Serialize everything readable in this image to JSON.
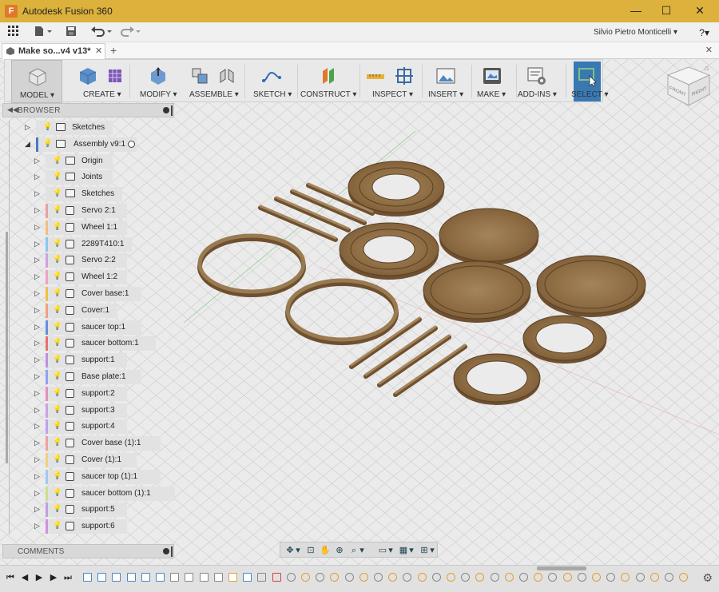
{
  "window": {
    "title": "Autodesk Fusion 360",
    "app_icon": "F",
    "minimize": "—",
    "maximize": "☐",
    "close": "✕"
  },
  "quick_access": {
    "user": "Silvio Pietro Monticelli ▾",
    "help": "?▾"
  },
  "tab": {
    "label": "Make so...v4 v13*",
    "close": "✕",
    "add": "+",
    "close_all": "✕"
  },
  "ribbon": {
    "model": "MODEL ▾",
    "groups": [
      {
        "label": "CREATE ▾"
      },
      {
        "label": "MODIFY ▾"
      },
      {
        "label": "ASSEMBLE ▾"
      },
      {
        "label": "SKETCH ▾"
      },
      {
        "label": "CONSTRUCT ▾"
      },
      {
        "label": "INSPECT ▾"
      },
      {
        "label": "INSERT ▾"
      },
      {
        "label": "MAKE ▾"
      },
      {
        "label": "ADD-INS ▾"
      },
      {
        "label": "SELECT ▾"
      }
    ]
  },
  "viewcube": {
    "top": "FRONT",
    "side": "RIGHT"
  },
  "browser": {
    "title": "BROWSER",
    "items": [
      {
        "label": "Sketches"
      },
      {
        "label": "Assembly v9:1"
      },
      {
        "label": "Origin"
      },
      {
        "label": "Joints"
      },
      {
        "label": "Sketches"
      },
      {
        "label": "Servo 2:1"
      },
      {
        "label": "Wheel 1:1"
      },
      {
        "label": "2289T410:1"
      },
      {
        "label": "Servo 2:2"
      },
      {
        "label": "Wheel 1:2"
      },
      {
        "label": "Cover base:1"
      },
      {
        "label": "Cover:1"
      },
      {
        "label": "saucer top:1"
      },
      {
        "label": "saucer bottom:1"
      },
      {
        "label": "support:1"
      },
      {
        "label": "Base plate:1"
      },
      {
        "label": "support:2"
      },
      {
        "label": "support:3"
      },
      {
        "label": "support:4"
      },
      {
        "label": "Cover base (1):1"
      },
      {
        "label": "Cover (1):1"
      },
      {
        "label": "saucer top (1):1"
      },
      {
        "label": "saucer bottom (1):1"
      },
      {
        "label": "support:5"
      },
      {
        "label": "support:6"
      }
    ]
  },
  "comments": {
    "title": "COMMENTS"
  },
  "colors": {
    "titlebar": "#dcb13c",
    "wood": "#9a7a50",
    "select_blue": "#3a78b4"
  }
}
